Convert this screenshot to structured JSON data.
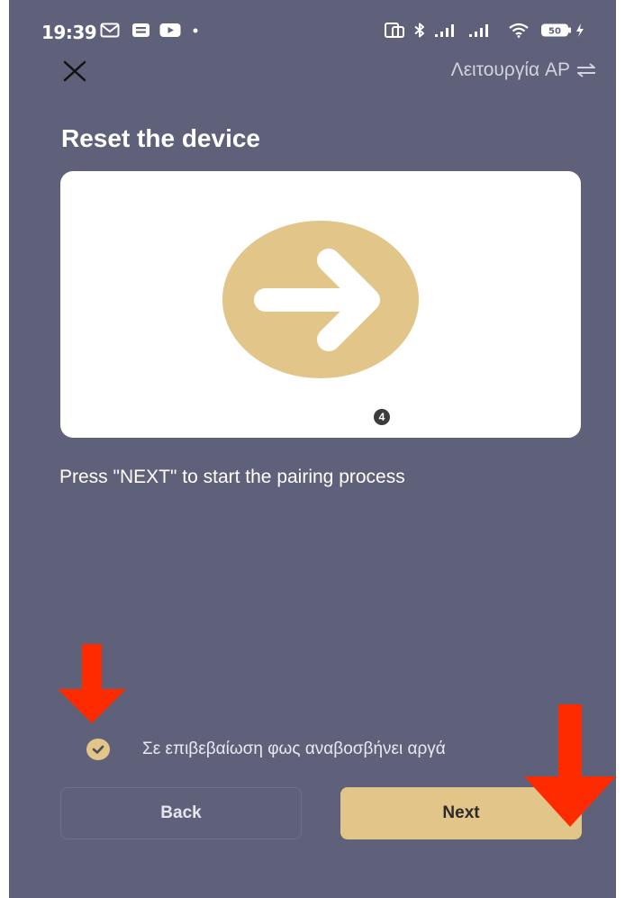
{
  "status_bar": {
    "time": "19:39",
    "battery": "50"
  },
  "header": {
    "close_icon": "close-icon",
    "mode_label": "Λειτουργία AP",
    "mode_icon": "swap-arrows-icon"
  },
  "main": {
    "title": "Reset the device",
    "illustration": {
      "icon": "arrow-right-icon",
      "accent_color": "#e2c589",
      "step_badge": "4"
    },
    "instruction": "Press \"NEXT\" to start the pairing process"
  },
  "confirm": {
    "checked": true,
    "label": "Σε επιβεβαίωση φως αναβοσβήνει αργά"
  },
  "footer": {
    "back_label": "Back",
    "next_label": "Next"
  },
  "colors": {
    "background": "#5f6079",
    "accent": "#e2c589",
    "annotation_red": "#ff2b00"
  }
}
